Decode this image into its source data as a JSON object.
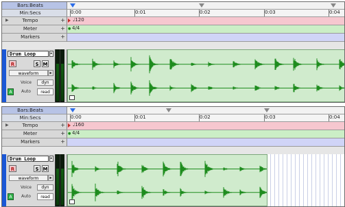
{
  "panels": [
    {
      "rulers": {
        "bars_beats_label": "Bars:Beats",
        "min_secs_label": "Min:Secs",
        "tempo_label": "Tempo",
        "meter_label": "Meter",
        "markers_label": "Markers",
        "plus_label": "+",
        "time_labels": [
          "0:00",
          "0:01",
          "0:02",
          "0:03",
          "0:04"
        ],
        "tempo_value": "120",
        "meter_value": "4/4"
      },
      "track": {
        "name": "Drum Loop",
        "rec_label": "R",
        "solo_label": "S",
        "mute_label": "M",
        "view_label": "waveform",
        "voice_label": "Voice",
        "voice_value": "dyn",
        "auto_icon_label": "A",
        "auto_label": "Auto",
        "auto_value": "read"
      },
      "region_fill_fraction": 1.0
    },
    {
      "rulers": {
        "bars_beats_label": "Bars:Beats",
        "min_secs_label": "Min:Secs",
        "tempo_label": "Tempo",
        "meter_label": "Meter",
        "markers_label": "Markers",
        "plus_label": "+",
        "time_labels": [
          "0:00",
          "0:01",
          "0:02",
          "0:03",
          "0:04"
        ],
        "tempo_value": "160",
        "meter_value": "4/4"
      },
      "track": {
        "name": "Drum Loop",
        "rec_label": "R",
        "solo_label": "S",
        "mute_label": "M",
        "view_label": "waveform",
        "voice_label": "Voice",
        "voice_value": "dyn",
        "auto_icon_label": "A",
        "auto_label": "Auto",
        "auto_value": "read"
      },
      "region_fill_fraction": 0.72
    }
  ],
  "icons": {
    "tempo_marker": "red-triangle-flag-icon",
    "meter_marker": "green-dot-icon",
    "playhead": "playhead-icon",
    "loop": "loop-icon"
  },
  "colors": {
    "bars_header": "#b7c3e6",
    "tempo_ruler": "#f6c7cf",
    "meter_ruler": "#cbeec6",
    "markers_ruler": "#d0d4f7",
    "track_strip": "#1a57d6",
    "waveform": "#1e8c1e",
    "region_bg": "#d0ebcd"
  }
}
